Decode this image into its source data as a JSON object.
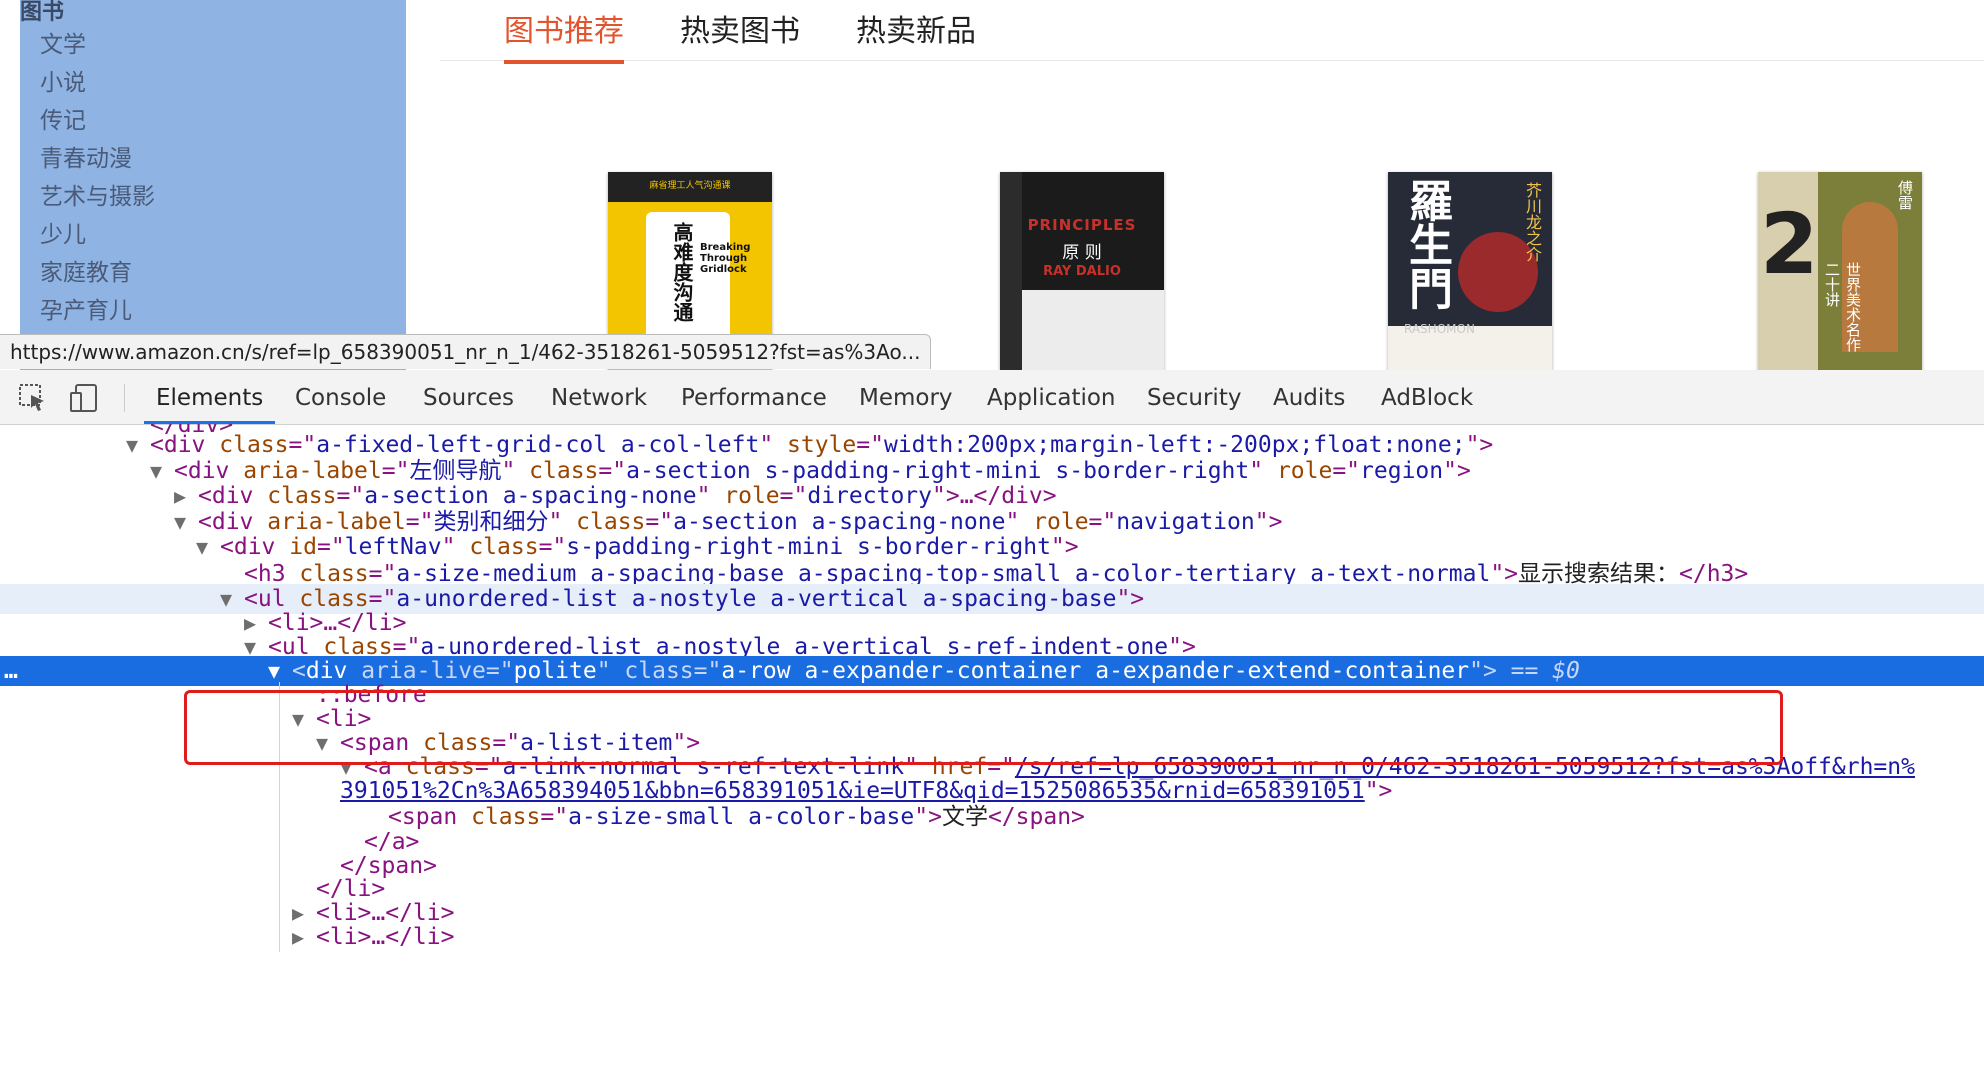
{
  "sidebar": {
    "header": "图书",
    "items": [
      "文学",
      "小说",
      "传记",
      "青春动漫",
      "艺术与摄影",
      "少儿",
      "家庭教育",
      "孕产育儿"
    ]
  },
  "tabs": {
    "active": "图书推荐",
    "second": "热卖图书",
    "third": "热卖新品"
  },
  "books": {
    "b1": {
      "banner": "麻省理工人气沟通课",
      "title": "高难度沟通",
      "en": "Breaking Through Gridlock"
    },
    "b2": {
      "title": "PRINCIPLES",
      "cn": "原 则",
      "author": "RAY DALIO"
    },
    "b3": {
      "title": "羅生門",
      "author": "芥川龙之介",
      "en": "RASHOMON"
    },
    "b4": {
      "title": "世界美术名作二十讲",
      "author": "傅雷"
    }
  },
  "status_url": "https://www.amazon.cn/s/ref=lp_658390051_nr_n_1/462-3518261-5059512?fst=as%3Ao...",
  "devtools": {
    "tabs": [
      "Elements",
      "Console",
      "Sources",
      "Network",
      "Performance",
      "Memory",
      "Application",
      "Security",
      "Audits",
      "AdBlock"
    ],
    "icons": {
      "inspect": "inspect-element-icon",
      "device": "device-toolbar-icon"
    },
    "selected_suffix": "== $0",
    "row_dots": "…",
    "lines": {
      "l0": "</div>",
      "l1": {
        "tag": "div",
        "a1": "class",
        "v1": "a-fixed-left-grid-col a-col-left",
        "a2": "style",
        "v2": "width:200px;margin-left:-200px;float:none;"
      },
      "l2": {
        "tag": "div",
        "a1": "aria-label",
        "v1": "左侧导航",
        "a2": "class",
        "v2": "a-section s-padding-right-mini s-border-right",
        "a3": "role",
        "v3": "region"
      },
      "l3": {
        "tag": "div",
        "a1": "class",
        "v1": "a-section a-spacing-none",
        "a2": "role",
        "v2": "directory",
        "rest": "…</div>"
      },
      "l4": {
        "tag": "div",
        "a1": "aria-label",
        "v1": "类别和细分",
        "a2": "class",
        "v2": "a-section a-spacing-none",
        "a3": "role",
        "v3": "navigation"
      },
      "l5": {
        "tag": "div",
        "a1": "id",
        "v1": "leftNav",
        "a2": "class",
        "v2": "s-padding-right-mini s-border-right"
      },
      "l6": {
        "tag": "h3",
        "a1": "class",
        "v1": "a-size-medium a-spacing-base a-spacing-top-small a-color-tertiary a-text-normal",
        "text": "显示搜索结果：",
        "close": "</h3>"
      },
      "l7": {
        "tag": "ul",
        "a1": "class",
        "v1": "a-unordered-list a-nostyle a-vertical a-spacing-base"
      },
      "l8": "<li>…</li>",
      "l9": {
        "tag": "ul",
        "a1": "class",
        "v1": "a-unordered-list a-nostyle a-vertical s-ref-indent-one"
      },
      "l10": {
        "tag": "div",
        "a1": "aria-live",
        "v1": "polite",
        "a2": "class",
        "v2": "a-row a-expander-container a-expander-extend-container"
      },
      "l11": "::before",
      "l12": "<li>",
      "l13": {
        "tag": "span",
        "a1": "class",
        "v1": "a-list-item"
      },
      "l14": {
        "tag": "a",
        "a1": "class",
        "v1": "a-link-normal s-ref-text-link",
        "a2": "href",
        "v2": "/s/ref=lp_658390051_nr_n_0/462-3518261-5059512?fst=as%3Aoff&rh=n%"
      },
      "l15": "391051%2Cn%3A658394051&bbn=658391051&ie=UTF8&qid=1525086535&rnid=658391051",
      "l16": {
        "tag": "span",
        "a1": "class",
        "v1": "a-size-small a-color-base",
        "text": "文学",
        "close": "</span>"
      },
      "l17": "</a>",
      "l18": "</span>",
      "l19": "</li>",
      "l20": "<li>…</li>",
      "l21": "<li>…</li>"
    }
  }
}
